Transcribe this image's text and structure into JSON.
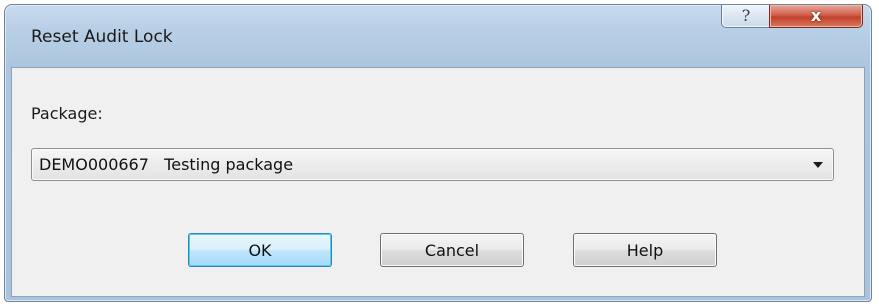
{
  "window": {
    "title": "Reset Audit Lock",
    "help_glyph": "?",
    "close_glyph": "x"
  },
  "form": {
    "package_label": "Package:",
    "package_selected": "DEMO000667   Testing package"
  },
  "buttons": {
    "ok": "OK",
    "cancel": "Cancel",
    "help": "Help"
  },
  "icons": {
    "dropdown": "chevron-down-icon",
    "help": "help-icon",
    "close": "close-icon"
  },
  "colors": {
    "titlebar": "#b9cfe6",
    "close_button": "#c9503a",
    "default_button_border": "#3c7fb1",
    "client_background": "#f0f0f0"
  }
}
